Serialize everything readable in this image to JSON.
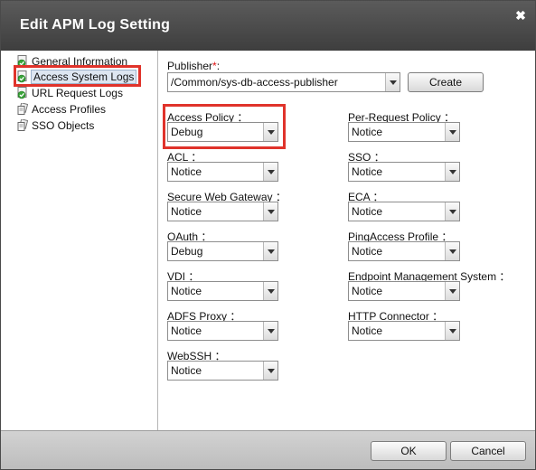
{
  "dialog": {
    "title": "Edit APM Log Setting",
    "close_glyph": "✖"
  },
  "sidebar": {
    "items": [
      {
        "label": "General Information",
        "icon": "check-page-icon"
      },
      {
        "label": "Access System Logs",
        "icon": "check-page-icon"
      },
      {
        "label": "URL Request Logs",
        "icon": "check-page-icon"
      },
      {
        "label": "Access Profiles",
        "icon": "pages-icon"
      },
      {
        "label": "SSO Objects",
        "icon": "pages-icon"
      }
    ],
    "selected_index": 1
  },
  "publisher": {
    "label": "Publisher",
    "required_mark": "*",
    "colon": ":",
    "value": "/Common/sys-db-access-publisher",
    "create_label": "Create"
  },
  "fields": {
    "access_policy": {
      "label": "Access Policy ：",
      "value": "Debug"
    },
    "per_request_policy": {
      "label": "Per-Request Policy ：",
      "value": "Notice"
    },
    "acl": {
      "label": "ACL ：",
      "value": "Notice"
    },
    "sso": {
      "label": "SSO ：",
      "value": "Notice"
    },
    "secure_web_gateway": {
      "label": "Secure Web Gateway ：",
      "value": "Notice"
    },
    "eca": {
      "label": "ECA ：",
      "value": "Notice"
    },
    "oauth": {
      "label": "OAuth ：",
      "value": "Debug"
    },
    "pingaccess_profile": {
      "label": "PingAccess Profile ：",
      "value": "Notice"
    },
    "vdi": {
      "label": "VDI ：",
      "value": "Notice"
    },
    "endpoint_management_system": {
      "label": "Endpoint Management System ：",
      "value": "Notice"
    },
    "adfs_proxy": {
      "label": "ADFS Proxy ：",
      "value": "Notice"
    },
    "http_connector": {
      "label": "HTTP Connector ：",
      "value": "Notice"
    },
    "webssh": {
      "label": "WebSSH ：",
      "value": "Notice"
    }
  },
  "footer": {
    "ok_label": "OK",
    "cancel_label": "Cancel"
  },
  "colors": {
    "highlight": "#e0332b",
    "titlebar": "#4a4a4a"
  }
}
